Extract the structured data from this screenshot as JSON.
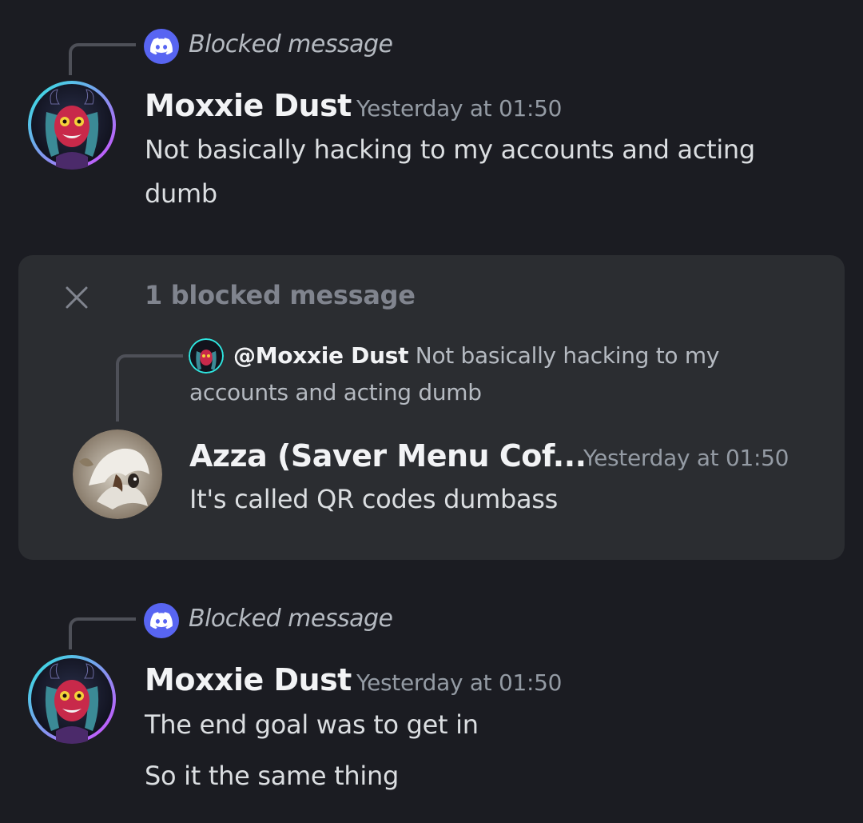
{
  "messages": [
    {
      "reply_ref": "Blocked message",
      "author": "Moxxie Dust",
      "timestamp": "Yesterday at 01:50",
      "lines": [
        "Not basically hacking to my accounts and acting",
        "dumb"
      ]
    },
    {
      "reply_ref": "Blocked message",
      "author": "Moxxie Dust",
      "timestamp": "Yesterday at 01:50",
      "lines": [
        "The end goal was to get in",
        "So it the same thing"
      ]
    }
  ],
  "blocked_panel": {
    "count_label": "1 blocked message",
    "close_icon": "close-icon",
    "reply": {
      "mention": "@Moxxie Dust",
      "preview_start": "Not basically hacking to my",
      "preview_end": "accounts and acting dumb"
    },
    "message": {
      "author": "Azza (Saver Menu Cof...",
      "timestamp": "Yesterday at 01:50",
      "text": "It's called QR codes dumbass"
    }
  },
  "colors": {
    "background": "#1b1c22",
    "panel": "#2b2d31",
    "blurple": "#5865f2",
    "avatar_ring_cyan": "#2ee6e0",
    "avatar_ring_pink": "#d24cff"
  }
}
